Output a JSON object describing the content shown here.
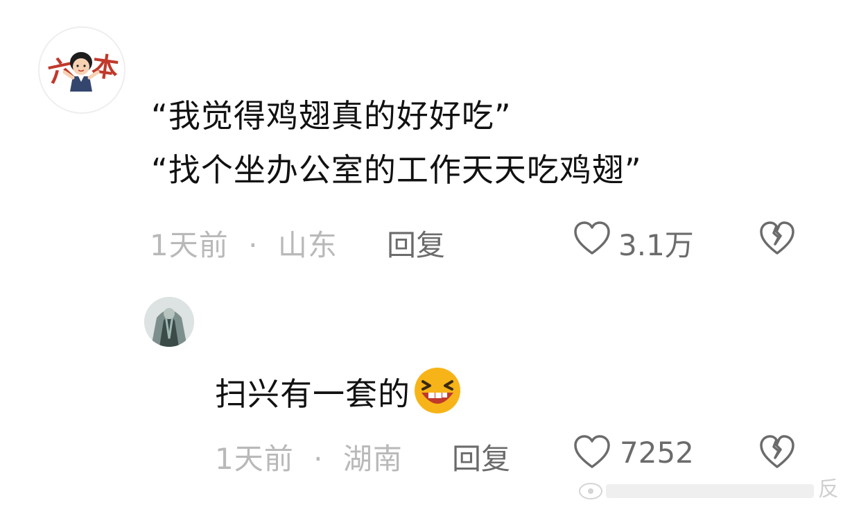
{
  "comment": {
    "lines": [
      "“我觉得鸡翅真的好好吃”",
      "“找个坐办公室的工作天天吃鸡翅”"
    ],
    "time": "1天前",
    "separator": "·",
    "location": "山东",
    "reply_label": "回复",
    "like_count": "3.1万",
    "avatar_text_left": "六",
    "avatar_text_right": "本"
  },
  "reply": {
    "text": "扫兴有一套的",
    "emoji": "grinning-squint-emoji",
    "time": "1天前",
    "separator": "·",
    "location": "湖南",
    "reply_label": "回复",
    "like_count": "7252"
  },
  "watermark": {
    "char": "反"
  },
  "colors": {
    "meta_gray": "#b9b9b9",
    "action_gray": "#6b6b6b",
    "avatar_red": "#c0392b",
    "emoji_yellow": "#f7b418",
    "emoji_mouth": "#c0392b"
  }
}
